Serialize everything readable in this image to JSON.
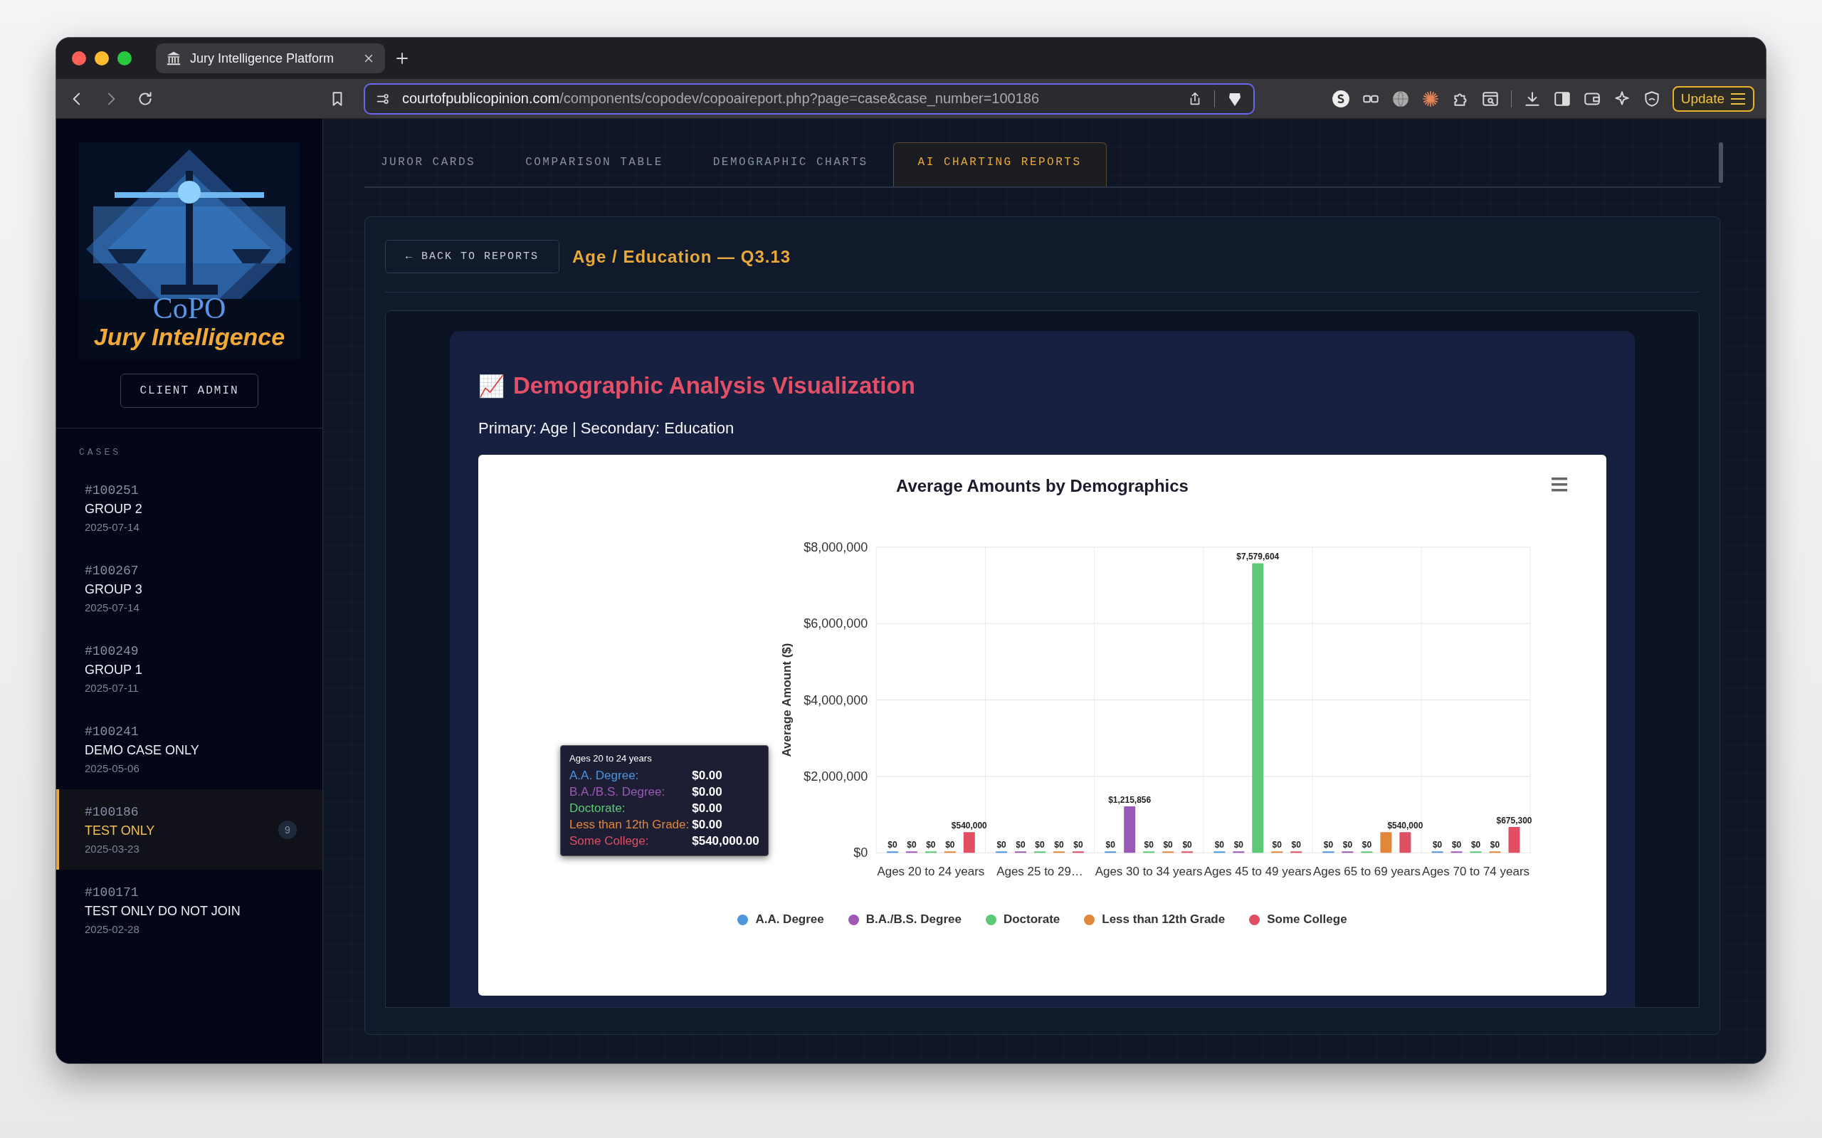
{
  "browser": {
    "tab_title": "Jury Intelligence Platform",
    "url": {
      "host": "courtofpublicopinion.com",
      "path": "/components/copodev/copoaireport.php?page=case&case_number=100186"
    },
    "update_button": "Update"
  },
  "sidebar": {
    "logo": {
      "line_1": "CoPO",
      "line_2": "Jury Intelligence"
    },
    "role_button": "CLIENT ADMIN",
    "section_label": "CASES",
    "cases": [
      {
        "number": "#100251",
        "name": "GROUP 2",
        "date": "2025-07-14",
        "selected": false
      },
      {
        "number": "#100267",
        "name": "GROUP 3",
        "date": "2025-07-14",
        "selected": false
      },
      {
        "number": "#100249",
        "name": "GROUP 1",
        "date": "2025-07-11",
        "selected": false
      },
      {
        "number": "#100241",
        "name": "DEMO CASE ONLY",
        "date": "2025-05-06",
        "selected": false
      },
      {
        "number": "#100186",
        "name": "TEST ONLY",
        "date": "2025-03-23",
        "selected": true,
        "badge": "9"
      },
      {
        "number": "#100171",
        "name": "TEST ONLY DO NOT JOIN",
        "date": "2025-02-28",
        "selected": false
      }
    ]
  },
  "tabs": [
    {
      "label": "JUROR CARDS",
      "selected": false
    },
    {
      "label": "COMPARISON TABLE",
      "selected": false
    },
    {
      "label": "DEMOGRAPHIC CHARTS",
      "selected": false
    },
    {
      "label": "AI CHARTING REPORTS",
      "selected": true
    }
  ],
  "report": {
    "back_button": "← BACK TO REPORTS",
    "title": "Age / Education — Q3.13",
    "heading_icon": "📈",
    "heading": "Demographic Analysis Visualization",
    "subtitle": "Primary: Age | Secondary: Education",
    "chart": {
      "chart_data": {
        "type": "bar",
        "title": "Average Amounts by Demographics",
        "ylabel": "Average Amount ($)",
        "categories": [
          "Ages 20 to 24 years",
          "Ages 25 to 29…",
          "Ages 30 to 34 years",
          "Ages 45 to 49 years",
          "Ages 65 to 69 years",
          "Ages 70 to 74 years"
        ],
        "series": [
          {
            "name": "A.A. Degree",
            "color": "#4f95dd",
            "values": [
              0,
              0,
              0,
              0,
              0,
              0
            ],
            "value_labels": [
              "$0",
              "$0",
              "$0",
              "$0",
              "$0",
              "$0"
            ]
          },
          {
            "name": "B.A./B.S. Degree",
            "color": "#9b59b6",
            "values": [
              0,
              0,
              1215856,
              0,
              0,
              0
            ],
            "value_labels": [
              "$0",
              "$0",
              "$1,215,856",
              "$0",
              "$0",
              "$0"
            ]
          },
          {
            "name": "Doctorate",
            "color": "#5cc976",
            "values": [
              0,
              0,
              0,
              7579604,
              0,
              0
            ],
            "value_labels": [
              "$0",
              "$0",
              "$0",
              "$7,579,604",
              "$0",
              "$0"
            ]
          },
          {
            "name": "Less than 12th Grade",
            "color": "#e2873a",
            "values": [
              0,
              0,
              0,
              0,
              540000,
              0
            ],
            "value_labels": [
              "$0",
              "$0",
              "$0",
              "$0",
              null,
              "$0"
            ]
          },
          {
            "name": "Some College",
            "color": "#e04e62",
            "values": [
              540000,
              0,
              0,
              0,
              540000,
              675300
            ],
            "value_labels": [
              "$540,000",
              "$0",
              "$0",
              "$0",
              "$540,000",
              "$675,300"
            ]
          }
        ],
        "ylim": [
          0,
          8000000
        ],
        "yticks": [
          {
            "value": 0,
            "label": "$0"
          },
          {
            "value": 2000000,
            "label": "$2,000,000"
          },
          {
            "value": 4000000,
            "label": "$4,000,000"
          },
          {
            "value": 6000000,
            "label": "$6,000,000"
          },
          {
            "value": 8000000,
            "label": "$8,000,000"
          }
        ],
        "data_labels": true,
        "grid": true,
        "legend": true
      },
      "tooltip": {
        "title": "Ages 20 to 24 years",
        "rows": [
          {
            "label": "A.A. Degree:",
            "value": "$0.00"
          },
          {
            "label": "B.A./B.S. Degree:",
            "value": "$0.00"
          },
          {
            "label": "Doctorate:",
            "value": "$0.00"
          },
          {
            "label": "Less than 12th Grade:",
            "value": "$0.00"
          },
          {
            "label": "Some College:",
            "value": "$540,000.00"
          }
        ]
      }
    }
  }
}
